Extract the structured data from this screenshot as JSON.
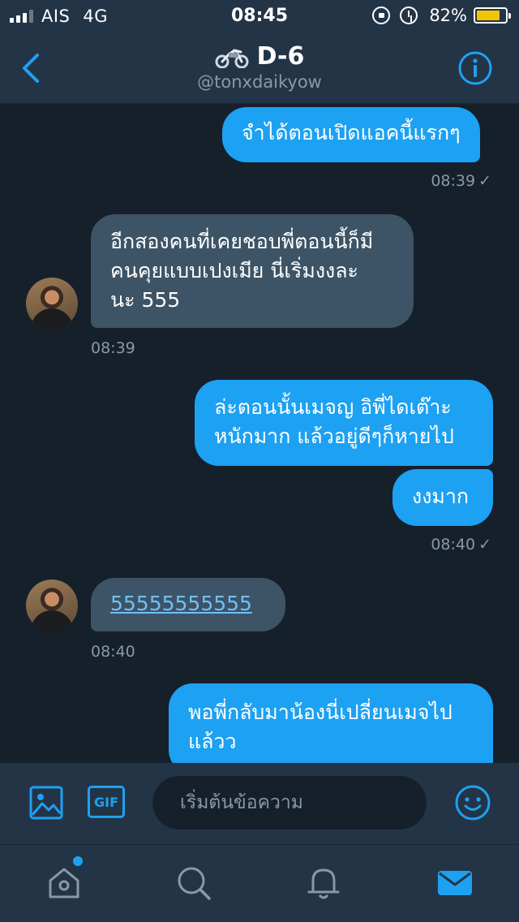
{
  "status_bar": {
    "carrier": "AIS",
    "network": "4G",
    "time": "08:45",
    "battery": "82%",
    "battery_level": 0.82
  },
  "header": {
    "title": "D-6",
    "handle": "@tonxdaikyow",
    "title_icon": "motorcycle-icon"
  },
  "messages": [
    {
      "direction": "out",
      "text": "จำได้ตอนเปิดแอคนี้แรกๆ"
    },
    {
      "direction": "out",
      "time": "08:39",
      "status": "✓"
    },
    {
      "direction": "in",
      "lines": [
        "อีกสองคนที่เคยชอบพี่ตอนนี้ก็มี",
        "คนคุยแบบเปงเมีย นี่เริ่มงงละ",
        "นะ 555"
      ]
    },
    {
      "direction": "in",
      "time": "08:39"
    },
    {
      "direction": "out",
      "lines": [
        "ล่ะตอนนั้นเมจญ อิพี่ไดเต๊าะ",
        "หนักมาก แล้วอยู่ดีๆก็หายไป"
      ]
    },
    {
      "direction": "out",
      "text": "งงมาก"
    },
    {
      "direction": "out",
      "time": "08:40",
      "status": "✓"
    },
    {
      "direction": "in",
      "text": "55555555555"
    },
    {
      "direction": "in",
      "time": "08:40"
    },
    {
      "direction": "out",
      "lines": [
        "พอพี่กลับมาน้องนี่เปลี่ยนเมจไป",
        "แล้วว"
      ]
    }
  ],
  "composer": {
    "placeholder": "เริ่มต้นข้อความ",
    "gif_label": "GIF"
  },
  "tabs": [
    "home-icon",
    "search-icon",
    "bell-icon",
    "mail-icon"
  ],
  "colors": {
    "accent": "#1da1f2",
    "background": "#15202b",
    "bar": "#243447",
    "incoming_bubble": "#3d5466",
    "muted": "#8899a6"
  }
}
